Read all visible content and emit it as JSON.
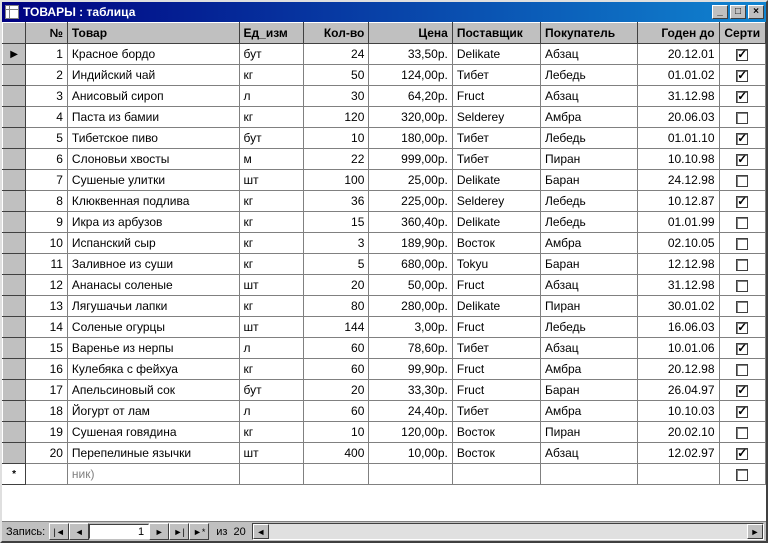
{
  "window": {
    "title": "ТОВАРЫ : таблица"
  },
  "columns": {
    "sel": "",
    "num": "№",
    "product": "Товар",
    "unit": "Ед_изм",
    "qty": "Кол-во",
    "price": "Цена",
    "supplier": "Поставщик",
    "buyer": "Покупатель",
    "date": "Годен до",
    "cert": "Серти"
  },
  "rows": [
    {
      "sel": "▶",
      "num": "1",
      "product": "Красное бордо",
      "unit": "бут",
      "qty": "24",
      "price": "33,50р.",
      "supplier": "Delikate",
      "buyer": "Абзац",
      "date": "20.12.01",
      "cert": true
    },
    {
      "sel": "",
      "num": "2",
      "product": "Индийский чай",
      "unit": "кг",
      "qty": "50",
      "price": "124,00р.",
      "supplier": "Тибет",
      "buyer": "Лебедь",
      "date": "01.01.02",
      "cert": true
    },
    {
      "sel": "",
      "num": "3",
      "product": "Анисовый сироп",
      "unit": "л",
      "qty": "30",
      "price": "64,20р.",
      "supplier": "Fruct",
      "buyer": "Абзац",
      "date": "31.12.98",
      "cert": true
    },
    {
      "sel": "",
      "num": "4",
      "product": "Паста из бамии",
      "unit": "кг",
      "qty": "120",
      "price": "320,00р.",
      "supplier": "Selderey",
      "buyer": "Амбра",
      "date": "20.06.03",
      "cert": false
    },
    {
      "sel": "",
      "num": "5",
      "product": "Тибетское пиво",
      "unit": "бут",
      "qty": "10",
      "price": "180,00р.",
      "supplier": "Тибет",
      "buyer": "Лебедь",
      "date": "01.01.10",
      "cert": true
    },
    {
      "sel": "",
      "num": "6",
      "product": "Слоновьи хвосты",
      "unit": "м",
      "qty": "22",
      "price": "999,00р.",
      "supplier": "Тибет",
      "buyer": "Пиран",
      "date": "10.10.98",
      "cert": true
    },
    {
      "sel": "",
      "num": "7",
      "product": "Сушеные улитки",
      "unit": "шт",
      "qty": "100",
      "price": "25,00р.",
      "supplier": "Delikate",
      "buyer": "Баран",
      "date": "24.12.98",
      "cert": false
    },
    {
      "sel": "",
      "num": "8",
      "product": "Клюквенная подлива",
      "unit": "кг",
      "qty": "36",
      "price": "225,00р.",
      "supplier": "Selderey",
      "buyer": "Лебедь",
      "date": "10.12.87",
      "cert": true
    },
    {
      "sel": "",
      "num": "9",
      "product": "Икра из арбузов",
      "unit": "кг",
      "qty": "15",
      "price": "360,40р.",
      "supplier": "Delikate",
      "buyer": "Лебедь",
      "date": "01.01.99",
      "cert": false
    },
    {
      "sel": "",
      "num": "10",
      "product": "Испанский сыр",
      "unit": "кг",
      "qty": "3",
      "price": "189,90р.",
      "supplier": "Восток",
      "buyer": "Амбра",
      "date": "02.10.05",
      "cert": false
    },
    {
      "sel": "",
      "num": "11",
      "product": "Заливное из суши",
      "unit": "кг",
      "qty": "5",
      "price": "680,00р.",
      "supplier": "Tokyu",
      "buyer": "Баран",
      "date": "12.12.98",
      "cert": false
    },
    {
      "sel": "",
      "num": "12",
      "product": "Ананасы соленые",
      "unit": "шт",
      "qty": "20",
      "price": "50,00р.",
      "supplier": "Fruct",
      "buyer": "Абзац",
      "date": "31.12.98",
      "cert": false
    },
    {
      "sel": "",
      "num": "13",
      "product": "Лягушачьи лапки",
      "unit": "кг",
      "qty": "80",
      "price": "280,00р.",
      "supplier": "Delikate",
      "buyer": "Пиран",
      "date": "30.01.02",
      "cert": false
    },
    {
      "sel": "",
      "num": "14",
      "product": "Соленые огурцы",
      "unit": "шт",
      "qty": "144",
      "price": "3,00р.",
      "supplier": "Fruct",
      "buyer": "Лебедь",
      "date": "16.06.03",
      "cert": true
    },
    {
      "sel": "",
      "num": "15",
      "product": "Варенье из нерпы",
      "unit": "л",
      "qty": "60",
      "price": "78,60р.",
      "supplier": "Тибет",
      "buyer": "Абзац",
      "date": "10.01.06",
      "cert": true
    },
    {
      "sel": "",
      "num": "16",
      "product": "Кулебяка с фейхуа",
      "unit": "кг",
      "qty": "60",
      "price": "99,90р.",
      "supplier": "Fruct",
      "buyer": "Амбра",
      "date": "20.12.98",
      "cert": false
    },
    {
      "sel": "",
      "num": "17",
      "product": "Апельсиновый сок",
      "unit": "бут",
      "qty": "20",
      "price": "33,30р.",
      "supplier": "Fruct",
      "buyer": "Баран",
      "date": "26.04.97",
      "cert": true
    },
    {
      "sel": "",
      "num": "18",
      "product": "Йогурт от лам",
      "unit": "л",
      "qty": "60",
      "price": "24,40р.",
      "supplier": "Тибет",
      "buyer": "Амбра",
      "date": "10.10.03",
      "cert": true
    },
    {
      "sel": "",
      "num": "19",
      "product": "Сушеная говядина",
      "unit": "кг",
      "qty": "10",
      "price": "120,00р.",
      "supplier": "Восток",
      "buyer": "Пиран",
      "date": "20.02.10",
      "cert": false
    },
    {
      "sel": "",
      "num": "20",
      "product": "Перепелиные язычки",
      "unit": "шт",
      "qty": "400",
      "price": "10,00р.",
      "supplier": "Восток",
      "buyer": "Абзац",
      "date": "12.02.97",
      "cert": true
    }
  ],
  "newrow": {
    "marker": "*",
    "product_placeholder": "ник)"
  },
  "navigator": {
    "label": "Запись:",
    "current": "1",
    "of_label": "из",
    "total": "20"
  }
}
